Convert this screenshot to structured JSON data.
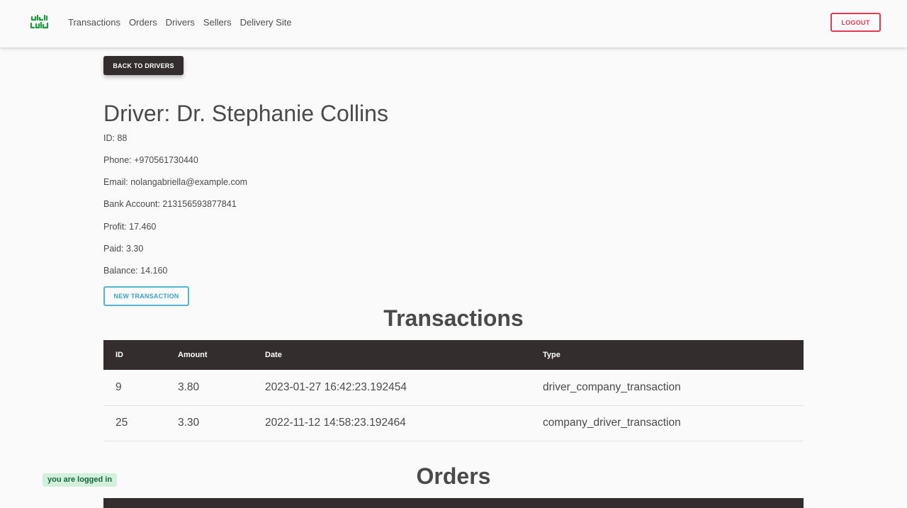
{
  "nav": {
    "brand_icon": "logo-arabic-wordmark",
    "links": [
      "Transactions",
      "Orders",
      "Drivers",
      "Sellers",
      "Delivery Site"
    ],
    "logout_label": "LOGOUT"
  },
  "back_button_label": "BACK TO DRIVERS",
  "driver": {
    "title": "Driver: Dr. Stephanie Collins",
    "id_line": "ID: 88",
    "phone_line": "Phone: +970561730440",
    "email_line": "Email: nolangabriella@example.com",
    "bank_line": "Bank Account: 213156593877841",
    "profit_line": "Profit: 17.460",
    "paid_line": "Paid: 3.30",
    "balance_line": "Balance: 14.160"
  },
  "new_transaction_label": "NEW TRANSACTION",
  "transactions": {
    "heading": "Transactions",
    "columns": [
      "ID",
      "Amount",
      "Date",
      "Type"
    ],
    "rows": [
      [
        "9",
        "3.80",
        "2023-01-27 16:42:23.192454",
        "driver_company_transaction"
      ],
      [
        "25",
        "3.30",
        "2022-11-12 14:58:23.192464",
        "company_driver_transaction"
      ]
    ]
  },
  "orders": {
    "heading": "Orders"
  },
  "status_badge": "you are logged in",
  "colors": {
    "brand_green": "#1a9c3c",
    "logout_red": "#e53950",
    "dark": "#332d2d",
    "info_blue": "#54b4d3",
    "badge_bg": "#d3f0dd",
    "badge_text": "#14683a"
  }
}
